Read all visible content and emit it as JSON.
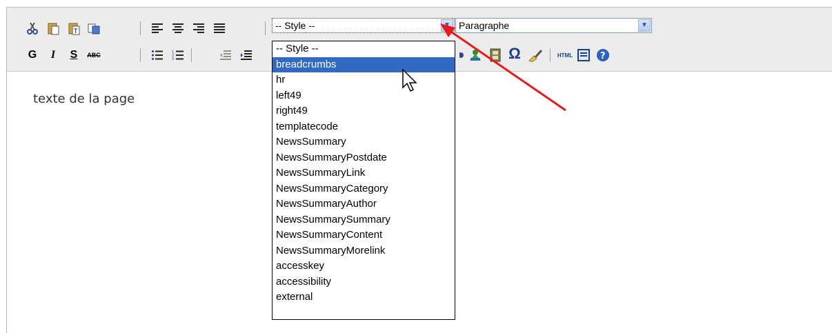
{
  "toolbar": {
    "style_select_value": "-- Style --",
    "format_select_value": "Paragraphe",
    "bold_label": "G",
    "italic_label": "I",
    "underline_label": "S",
    "strikethrough_label": "ABC",
    "html_label": "HTML",
    "omega_label": "Ω"
  },
  "dropdown": {
    "options": [
      "-- Style --",
      "breadcrumbs",
      "hr",
      "left49",
      "right49",
      "templatecode",
      "NewsSummary",
      "NewsSummaryPostdate",
      "NewsSummaryLink",
      "NewsSummaryCategory",
      "NewsSummaryAuthor",
      "NewsSummarySummary",
      "NewsSummaryContent",
      "NewsSummaryMorelink",
      "accesskey",
      "accessibility",
      "external"
    ],
    "selected_index": 1
  },
  "editor": {
    "content_text": "texte de la page"
  },
  "annotation": {
    "arrow_color": "#e8191a"
  }
}
